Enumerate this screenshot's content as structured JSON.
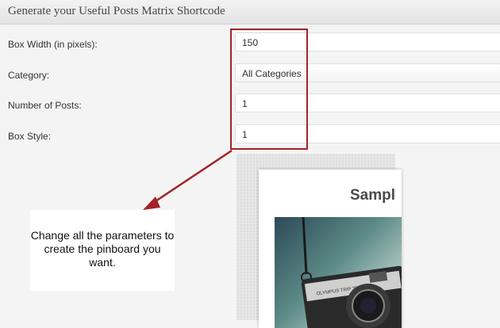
{
  "header": {
    "title": "Generate your Useful Posts Matrix Shortcode"
  },
  "form": {
    "rows": [
      {
        "label": "Box Width (in pixels):",
        "value": "150"
      },
      {
        "label": "Category:",
        "value": "All Categories"
      },
      {
        "label": "Number of Posts:",
        "value": "1"
      },
      {
        "label": "Box Style:",
        "value": "1"
      }
    ]
  },
  "preview": {
    "title": "Sampl",
    "camera_brand": "OLYMPUS TRIP 35"
  },
  "callout": {
    "text": "Change all the parameters to create the pinboard you want."
  },
  "colors": {
    "highlight": "#a32227",
    "header_bg": "#e4e4e4"
  }
}
